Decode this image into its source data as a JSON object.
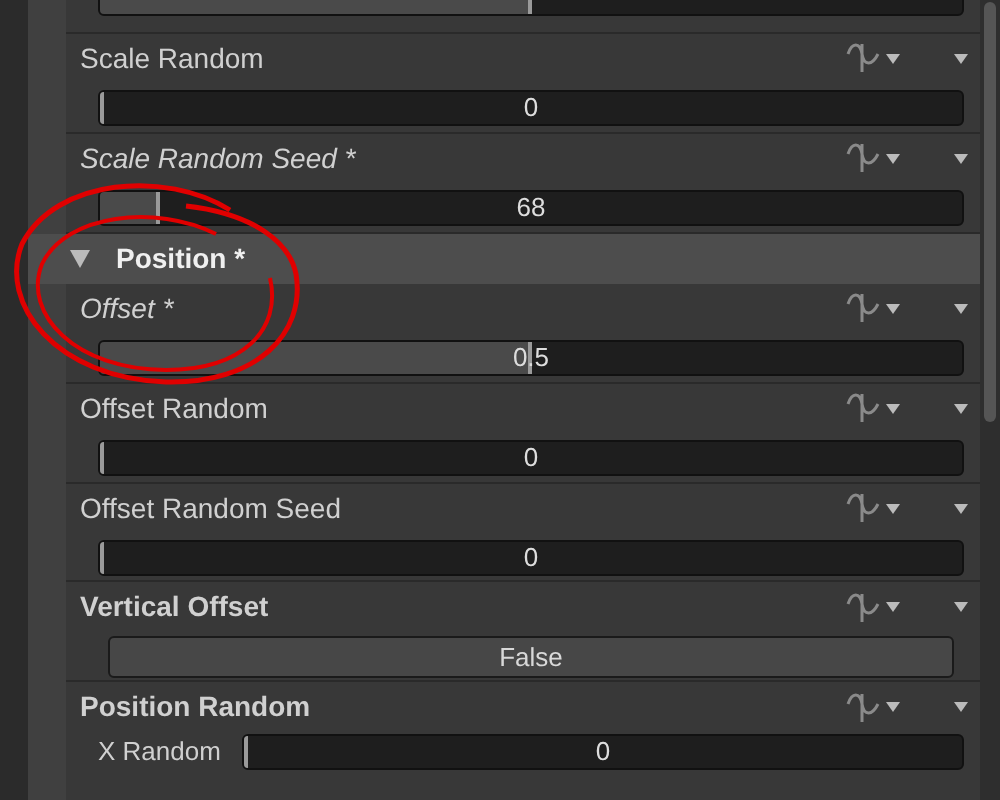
{
  "properties": [
    {
      "kind": "slider",
      "level": 0.5
    },
    {
      "kind": "slider",
      "label": "Scale Random",
      "overridden": false,
      "value": "0",
      "level": 0
    },
    {
      "kind": "slider",
      "label": "Scale Random Seed *",
      "overridden": true,
      "value": "68",
      "level": 0.07
    },
    {
      "kind": "section",
      "label": "Position *",
      "expanded": true
    },
    {
      "kind": "slider",
      "label": "Offset *",
      "overridden": true,
      "value": "0.5",
      "level": 0.5
    },
    {
      "kind": "slider",
      "label": "Offset Random",
      "overridden": false,
      "value": "0",
      "level": 0
    },
    {
      "kind": "slider",
      "label": "Offset Random Seed",
      "overridden": false,
      "value": "0",
      "level": 0
    },
    {
      "kind": "toggle",
      "label": "Vertical Offset",
      "overridden": false,
      "value": "False"
    },
    {
      "kind": "vector",
      "label": "Position Random",
      "overridden": false,
      "components": [
        {
          "label": "X Random",
          "value": "0",
          "level": 0
        }
      ]
    }
  ]
}
